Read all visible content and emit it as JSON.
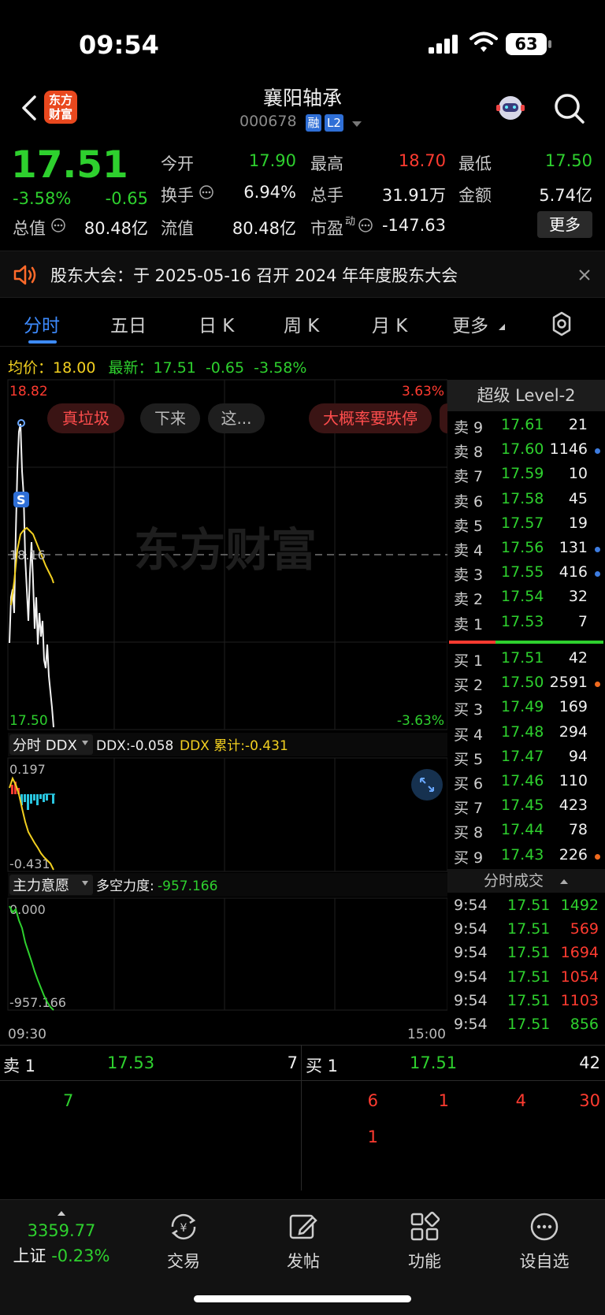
{
  "status_bar": {
    "time": "09:54",
    "battery": "63"
  },
  "nav": {
    "title": "襄阳轴承",
    "code": "000678",
    "tag_rong": "融",
    "tag_l2": "L2",
    "logo_text": "东方财富"
  },
  "quote": {
    "price": "17.51",
    "change_pct": "-3.58%",
    "change": "-0.65",
    "open_label": "今开",
    "open": "17.90",
    "high_label": "最高",
    "high": "18.70",
    "low_label": "最低",
    "low": "17.50",
    "turnover_label": "换手",
    "turnover": "6.94%",
    "volume_label": "总手",
    "volume": "31.91万",
    "amount_label": "金额",
    "amount": "5.74亿",
    "mktcap_label": "总值",
    "mktcap": "80.48亿",
    "float_label": "流值",
    "float": "80.48亿",
    "pe_label": "市盈",
    "pe_sup": "动",
    "pe": "-147.63",
    "more_label": "更多"
  },
  "notice": {
    "text": "股东大会：于 2025-05-16 召开 2024 年年度股东大会"
  },
  "tabs": [
    "分时",
    "五日",
    "日 K",
    "周 K",
    "月 K",
    "更多"
  ],
  "avg_line": {
    "avg_label": "均价：",
    "avg": "18.00",
    "latest_label": "最新：",
    "latest": "17.51",
    "chg": "-0.65",
    "chg_pct": "-3.58%"
  },
  "main_chart": {
    "top_price": "18.82",
    "top_pct": "3.63%",
    "mid_price": "18.16",
    "bottom_price": "17.50",
    "bottom_pct": "-3.63%",
    "watermark": "东方财富",
    "s_marker": "S",
    "bubbles": [
      "真垃圾",
      "下来",
      "这...",
      "大概率要跌停"
    ]
  },
  "ddx": {
    "selector": "分时 DDX",
    "ddx_label": "DDX:-0.058",
    "ddx_sum": "DDX 累计:-0.431",
    "top": "0.197",
    "bottom": "-0.431"
  },
  "zlyy": {
    "selector": "主力意愿",
    "label": "多空力度:",
    "value": "-957.166",
    "top": "0.000",
    "bottom": "-957.166"
  },
  "time_axis": {
    "start": "09:30",
    "end": "15:00"
  },
  "level2": {
    "title": "超级 Level-2",
    "asks": [
      {
        "label": "卖 9",
        "price": "17.61",
        "vol": "21",
        "dot": ""
      },
      {
        "label": "卖 8",
        "price": "17.60",
        "vol": "1146",
        "dot": "#3d7ce0"
      },
      {
        "label": "卖 7",
        "price": "17.59",
        "vol": "10",
        "dot": ""
      },
      {
        "label": "卖 6",
        "price": "17.58",
        "vol": "45",
        "dot": ""
      },
      {
        "label": "卖 5",
        "price": "17.57",
        "vol": "19",
        "dot": ""
      },
      {
        "label": "卖 4",
        "price": "17.56",
        "vol": "131",
        "dot": "#3d7ce0"
      },
      {
        "label": "卖 3",
        "price": "17.55",
        "vol": "416",
        "dot": "#3d7ce0"
      },
      {
        "label": "卖 2",
        "price": "17.54",
        "vol": "32",
        "dot": ""
      },
      {
        "label": "卖 1",
        "price": "17.53",
        "vol": "7",
        "dot": ""
      }
    ],
    "bids": [
      {
        "label": "买 1",
        "price": "17.51",
        "vol": "42",
        "dot": ""
      },
      {
        "label": "买 2",
        "price": "17.50",
        "vol": "2591",
        "dot": "#f06a1e"
      },
      {
        "label": "买 3",
        "price": "17.49",
        "vol": "169",
        "dot": ""
      },
      {
        "label": "买 4",
        "price": "17.48",
        "vol": "294",
        "dot": ""
      },
      {
        "label": "买 5",
        "price": "17.47",
        "vol": "94",
        "dot": ""
      },
      {
        "label": "买 6",
        "price": "17.46",
        "vol": "110",
        "dot": ""
      },
      {
        "label": "买 7",
        "price": "17.45",
        "vol": "423",
        "dot": ""
      },
      {
        "label": "买 8",
        "price": "17.44",
        "vol": "78",
        "dot": ""
      },
      {
        "label": "买 9",
        "price": "17.43",
        "vol": "226",
        "dot": "#f06a1e"
      }
    ],
    "trades_title": "分时成交",
    "trades": [
      {
        "time": "9:54",
        "price": "17.51",
        "vol": "1492",
        "color": "green"
      },
      {
        "time": "9:54",
        "price": "17.51",
        "vol": "569",
        "color": "red"
      },
      {
        "time": "9:54",
        "price": "17.51",
        "vol": "1694",
        "color": "red"
      },
      {
        "time": "9:54",
        "price": "17.51",
        "vol": "1054",
        "color": "red"
      },
      {
        "time": "9:54",
        "price": "17.51",
        "vol": "1103",
        "color": "red"
      },
      {
        "time": "9:54",
        "price": "17.51",
        "vol": "856",
        "color": "green"
      }
    ]
  },
  "queue": {
    "sell_label": "卖 1",
    "sell_price": "17.53",
    "sell_vol": "7",
    "buy_label": "买 1",
    "buy_price": "17.51",
    "buy_vol": "42",
    "sell_orders": [
      "7"
    ],
    "buy_orders_row1": [
      "6",
      "1",
      "4",
      "30"
    ],
    "buy_orders_row2": [
      "1"
    ]
  },
  "bottom_bar": {
    "index_value": "3359.77",
    "index_name": "上证",
    "index_chg": "-0.23%",
    "items": [
      "交易",
      "发帖",
      "功能",
      "设自选"
    ]
  }
}
